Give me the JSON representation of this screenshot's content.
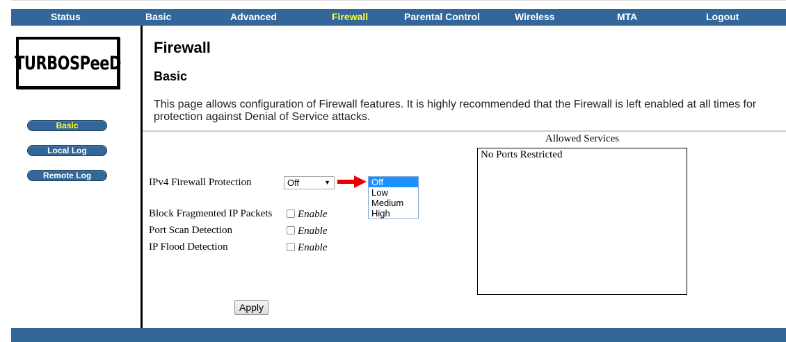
{
  "nav": {
    "items": [
      {
        "label": "Status"
      },
      {
        "label": "Basic"
      },
      {
        "label": "Advanced"
      },
      {
        "label": "Firewall",
        "active": true
      },
      {
        "label": "Parental Control"
      },
      {
        "label": "Wireless"
      },
      {
        "label": "MTA"
      },
      {
        "label": "Logout"
      }
    ]
  },
  "logo": {
    "text": "TURBOSPeeD"
  },
  "sidebar": {
    "items": [
      {
        "label": "Basic",
        "active": true
      },
      {
        "label": "Local Log"
      },
      {
        "label": "Remote Log"
      }
    ]
  },
  "page": {
    "title": "Firewall",
    "subtitle": "Basic",
    "description": "This page allows configuration of Firewall features. It is highly recommended that the Firewall is left enabled at all times for protection against Denial of Service attacks."
  },
  "form": {
    "protection_label": "IPv4 Firewall Protection",
    "protection_value": "Off",
    "protection_options": [
      "Off",
      "Low",
      "Medium",
      "High"
    ],
    "options": [
      {
        "label": "Block Fragmented IP Packets",
        "checkbox_label": "Enable",
        "checked": false
      },
      {
        "label": "Port Scan Detection",
        "checkbox_label": "Enable",
        "checked": false
      },
      {
        "label": "IP Flood Detection",
        "checkbox_label": "Enable",
        "checked": false
      }
    ],
    "apply_label": "Apply"
  },
  "services": {
    "title": "Allowed Services",
    "content": "No Ports Restricted"
  },
  "colors": {
    "nav_bg": "#336699",
    "active_text": "#ffff33",
    "highlight_arrow": "#ee0000",
    "selected_option": "#1e90ff"
  }
}
